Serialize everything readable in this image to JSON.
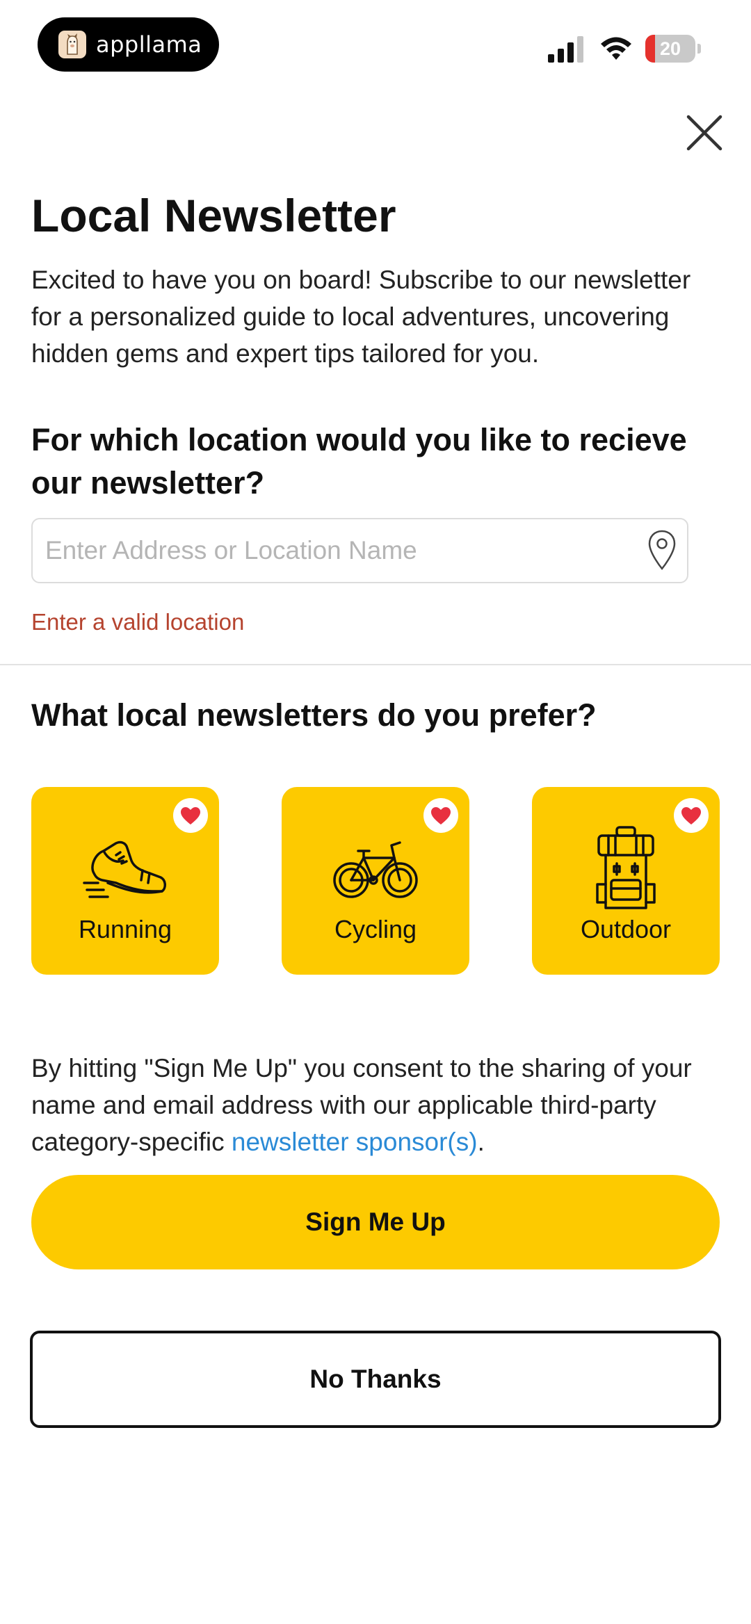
{
  "status_bar": {
    "app_name": "appllama",
    "battery_level": "20",
    "battery_fraction": 0.2,
    "icons": [
      "llama-logo-icon",
      "cellular-signal-icon",
      "wifi-icon",
      "battery-icon"
    ]
  },
  "dialog": {
    "close_icon": "close-icon",
    "title": "Local Newsletter",
    "intro": "Excited to have you on board! Subscribe to our newsletter for a personalized guide to local adventures, uncovering hidden gems and expert tips tailored for you.",
    "location_question": "For which location would you like to recieve our newsletter?",
    "location_input": {
      "value": "",
      "placeholder": "Enter Address or Location Name",
      "icon": "location-pin-icon"
    },
    "location_error": "Enter a valid location",
    "preferences_title": "What local newsletters do you prefer?",
    "categories": [
      {
        "label": "Running",
        "icon": "running-shoe-icon",
        "favorited": true
      },
      {
        "label": "Cycling",
        "icon": "bicycle-icon",
        "favorited": true
      },
      {
        "label": "Outdoor",
        "icon": "backpack-icon",
        "favorited": true
      }
    ],
    "consent": {
      "text_before": "By hitting \"Sign Me Up\" you consent to the sharing of your name and email address with our applicable third-party category-specific ",
      "link_text": "newsletter sponsor(s)",
      "text_after": "."
    },
    "sign_up_label": "Sign Me Up",
    "no_thanks_label": "No Thanks"
  },
  "colors": {
    "accent_yellow": "#fdca00",
    "error_text": "#b5432e",
    "link_blue": "#2a8ad6",
    "heart_red": "#e8303f",
    "battery_red": "#e5322d"
  }
}
